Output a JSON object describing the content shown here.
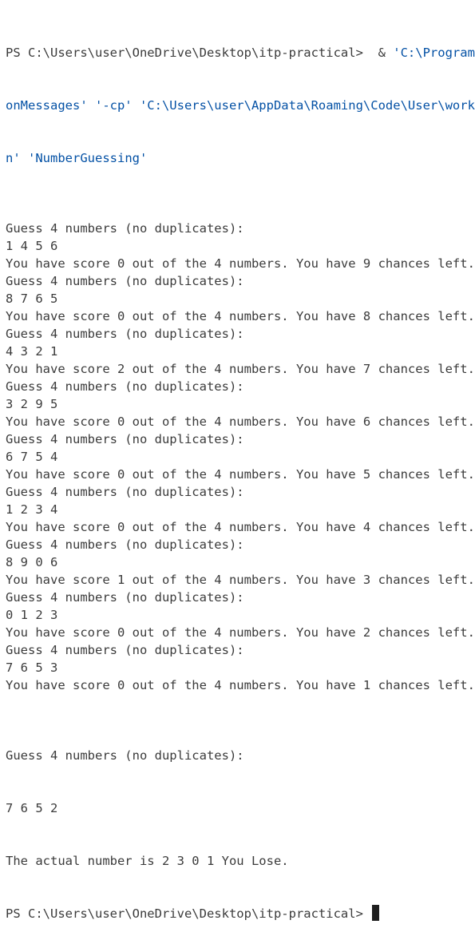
{
  "terminal": {
    "command": {
      "prompt": "PS C:\\Users\\user\\OneDrive\\Desktop\\itp-practical> ",
      "operator": " & ",
      "arg1": "'C:\\Program Fi",
      "line2": "onMessages' '-cp' 'C:\\Users\\user\\AppData\\Roaming\\Code\\User\\workspa",
      "line3_arg": "n'",
      "line3_space": " ",
      "line3_class": "'NumberGuessing'"
    },
    "rounds": [
      {
        "prompt": "Guess 4 numbers (no duplicates):",
        "guess": "1 4 5 6",
        "result": "You have score 0 out of the 4 numbers. You have 9 chances left."
      },
      {
        "prompt": "Guess 4 numbers (no duplicates):",
        "guess": "8 7 6 5",
        "result": "You have score 0 out of the 4 numbers. You have 8 chances left."
      },
      {
        "prompt": "Guess 4 numbers (no duplicates):",
        "guess": "4 3 2 1",
        "result": "You have score 2 out of the 4 numbers. You have 7 chances left."
      },
      {
        "prompt": "Guess 4 numbers (no duplicates):",
        "guess": "3 2 9 5",
        "result": "You have score 0 out of the 4 numbers. You have 6 chances left."
      },
      {
        "prompt": "Guess 4 numbers (no duplicates):",
        "guess": "6 7 5 4",
        "result": "You have score 0 out of the 4 numbers. You have 5 chances left."
      },
      {
        "prompt": "Guess 4 numbers (no duplicates):",
        "guess": "1 2 3 4",
        "result": "You have score 0 out of the 4 numbers. You have 4 chances left."
      },
      {
        "prompt": "Guess 4 numbers (no duplicates):",
        "guess": "8 9 0 6",
        "result": "You have score 1 out of the 4 numbers. You have 3 chances left."
      },
      {
        "prompt": "Guess 4 numbers (no duplicates):",
        "guess": "0 1 2 3",
        "result": "You have score 0 out of the 4 numbers. You have 2 chances left."
      },
      {
        "prompt": "Guess 4 numbers (no duplicates):",
        "guess": "7 6 5 3",
        "result": "You have score 0 out of the 4 numbers. You have 1 chances left."
      }
    ],
    "final_round": {
      "prompt": "Guess 4 numbers (no duplicates):",
      "guess": "7 6 5 2"
    },
    "result_line": "The actual number is 2 3 0 1 You Lose.",
    "final_prompt": "PS C:\\Users\\user\\OneDrive\\Desktop\\itp-practical> "
  },
  "colors": {
    "text": "#3b3b3b",
    "string_arg": "#0451a5",
    "background": "#ffffff",
    "cursor": "#1e1e1e"
  }
}
